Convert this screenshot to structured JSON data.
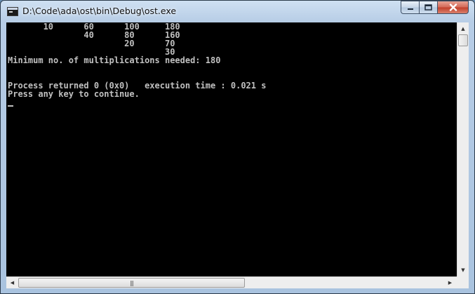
{
  "window": {
    "title": "D:\\Code\\ada\\ost\\bin\\Debug\\ost.exe"
  },
  "console": {
    "lines": [
      "       10      60      100     180",
      "               40      80      160",
      "                       20      70",
      "                               30",
      "Minimum no. of multiplications needed: 180",
      "",
      "",
      "Process returned 0 (0x0)   execution time : 0.021 s",
      "Press any key to continue."
    ]
  },
  "icons": {
    "app": "console-app-icon",
    "minimize": "minimize-icon",
    "maximize": "maximize-icon",
    "close": "close-icon"
  }
}
